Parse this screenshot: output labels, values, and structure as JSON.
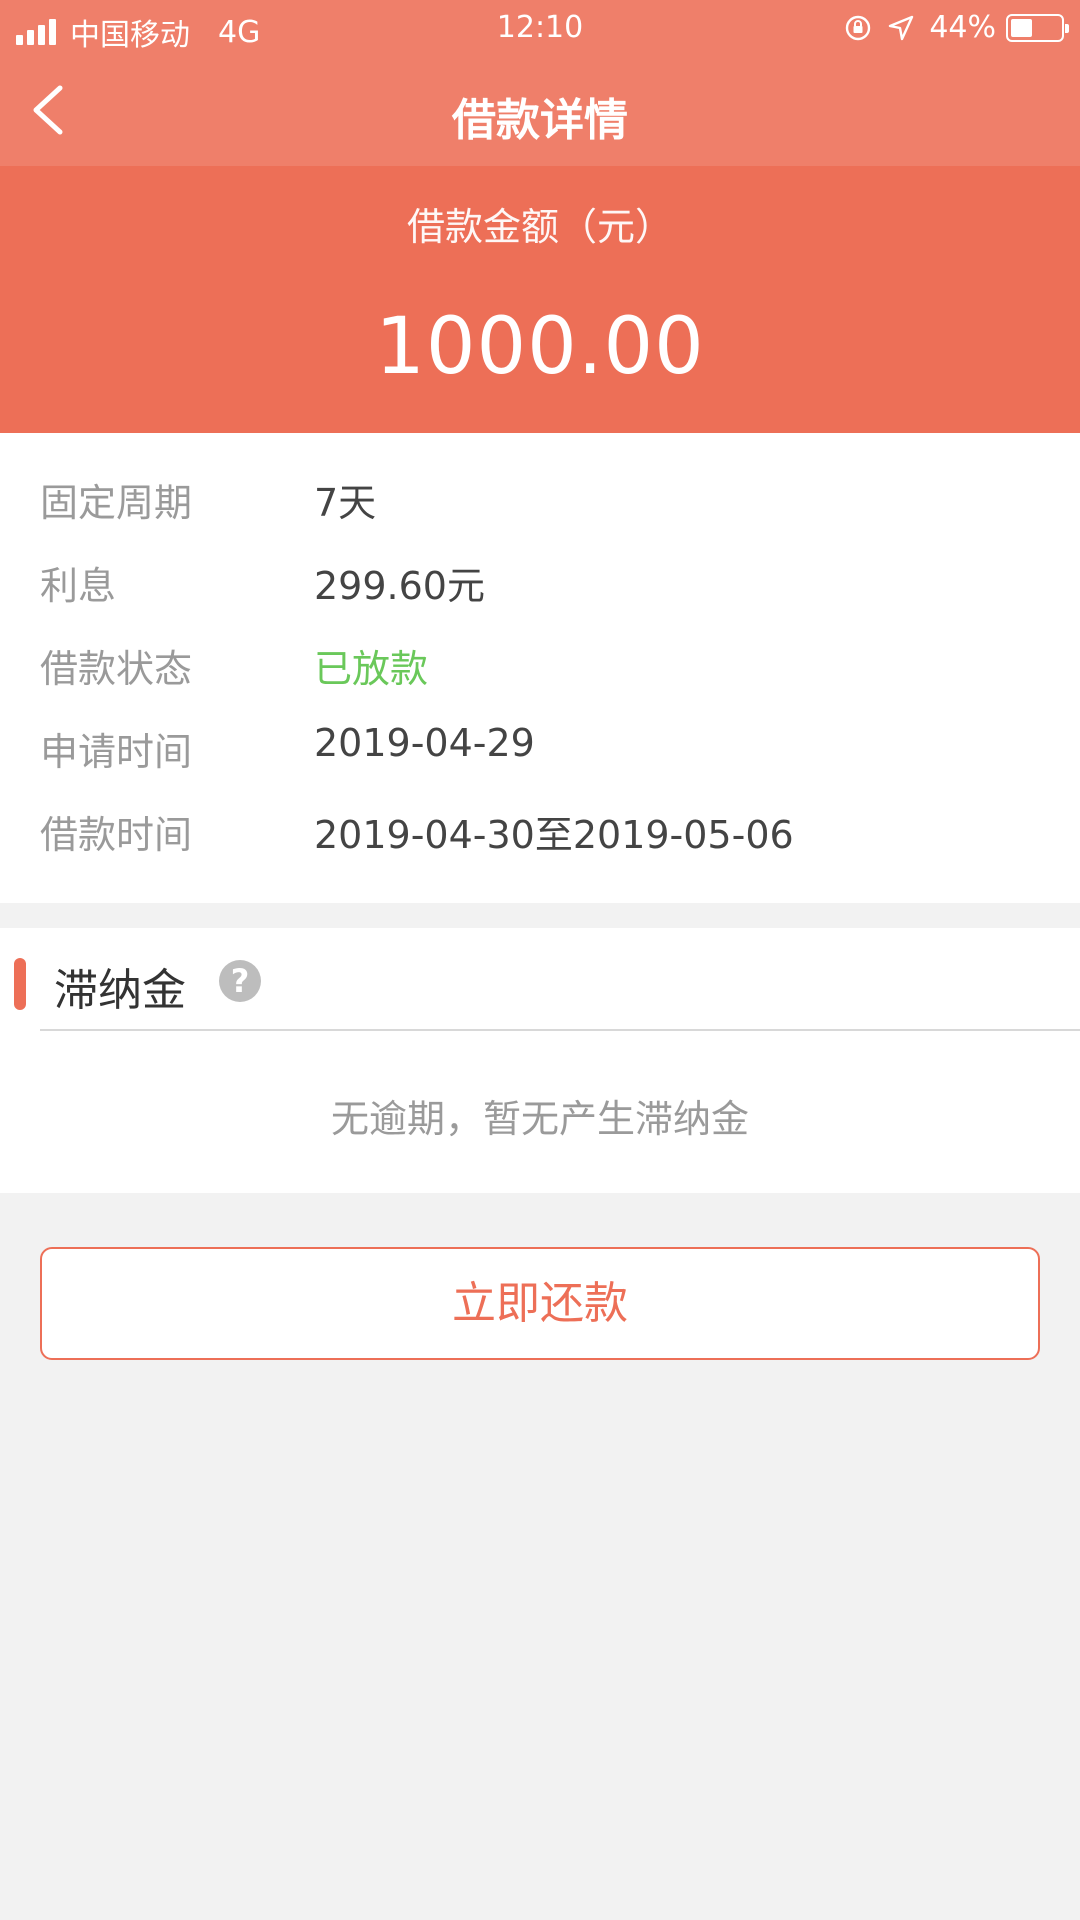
{
  "status_bar": {
    "carrier": "中国移动",
    "network": "4G",
    "time": "12:10",
    "battery": "44%",
    "battery_level": 0.44
  },
  "nav": {
    "title": "借款详情"
  },
  "hero": {
    "label": "借款金额（元）",
    "amount": "1000.00"
  },
  "details": [
    {
      "key": "固定周期",
      "value": "7天"
    },
    {
      "key": "利息",
      "value": "299.60元"
    },
    {
      "key": "借款状态",
      "value": "已放款"
    },
    {
      "key": "申请时间",
      "value": "2019-04-29"
    },
    {
      "key": "借款时间",
      "value": "2019-04-30至2019-05-06"
    }
  ],
  "late_fee": {
    "title": "滞纳金",
    "help": "?",
    "message": "无逾期，暂无产生滞纳金"
  },
  "actions": {
    "repay_label": "立即还款"
  },
  "colors": {
    "header": "#ef7f6a",
    "hero": "#ed6f57",
    "status_green": "#6ac85a"
  },
  "icons": [
    "signal-icon",
    "orientation-lock-icon",
    "location-arrow-icon",
    "battery-icon",
    "back-arrow-icon",
    "help-icon"
  ]
}
